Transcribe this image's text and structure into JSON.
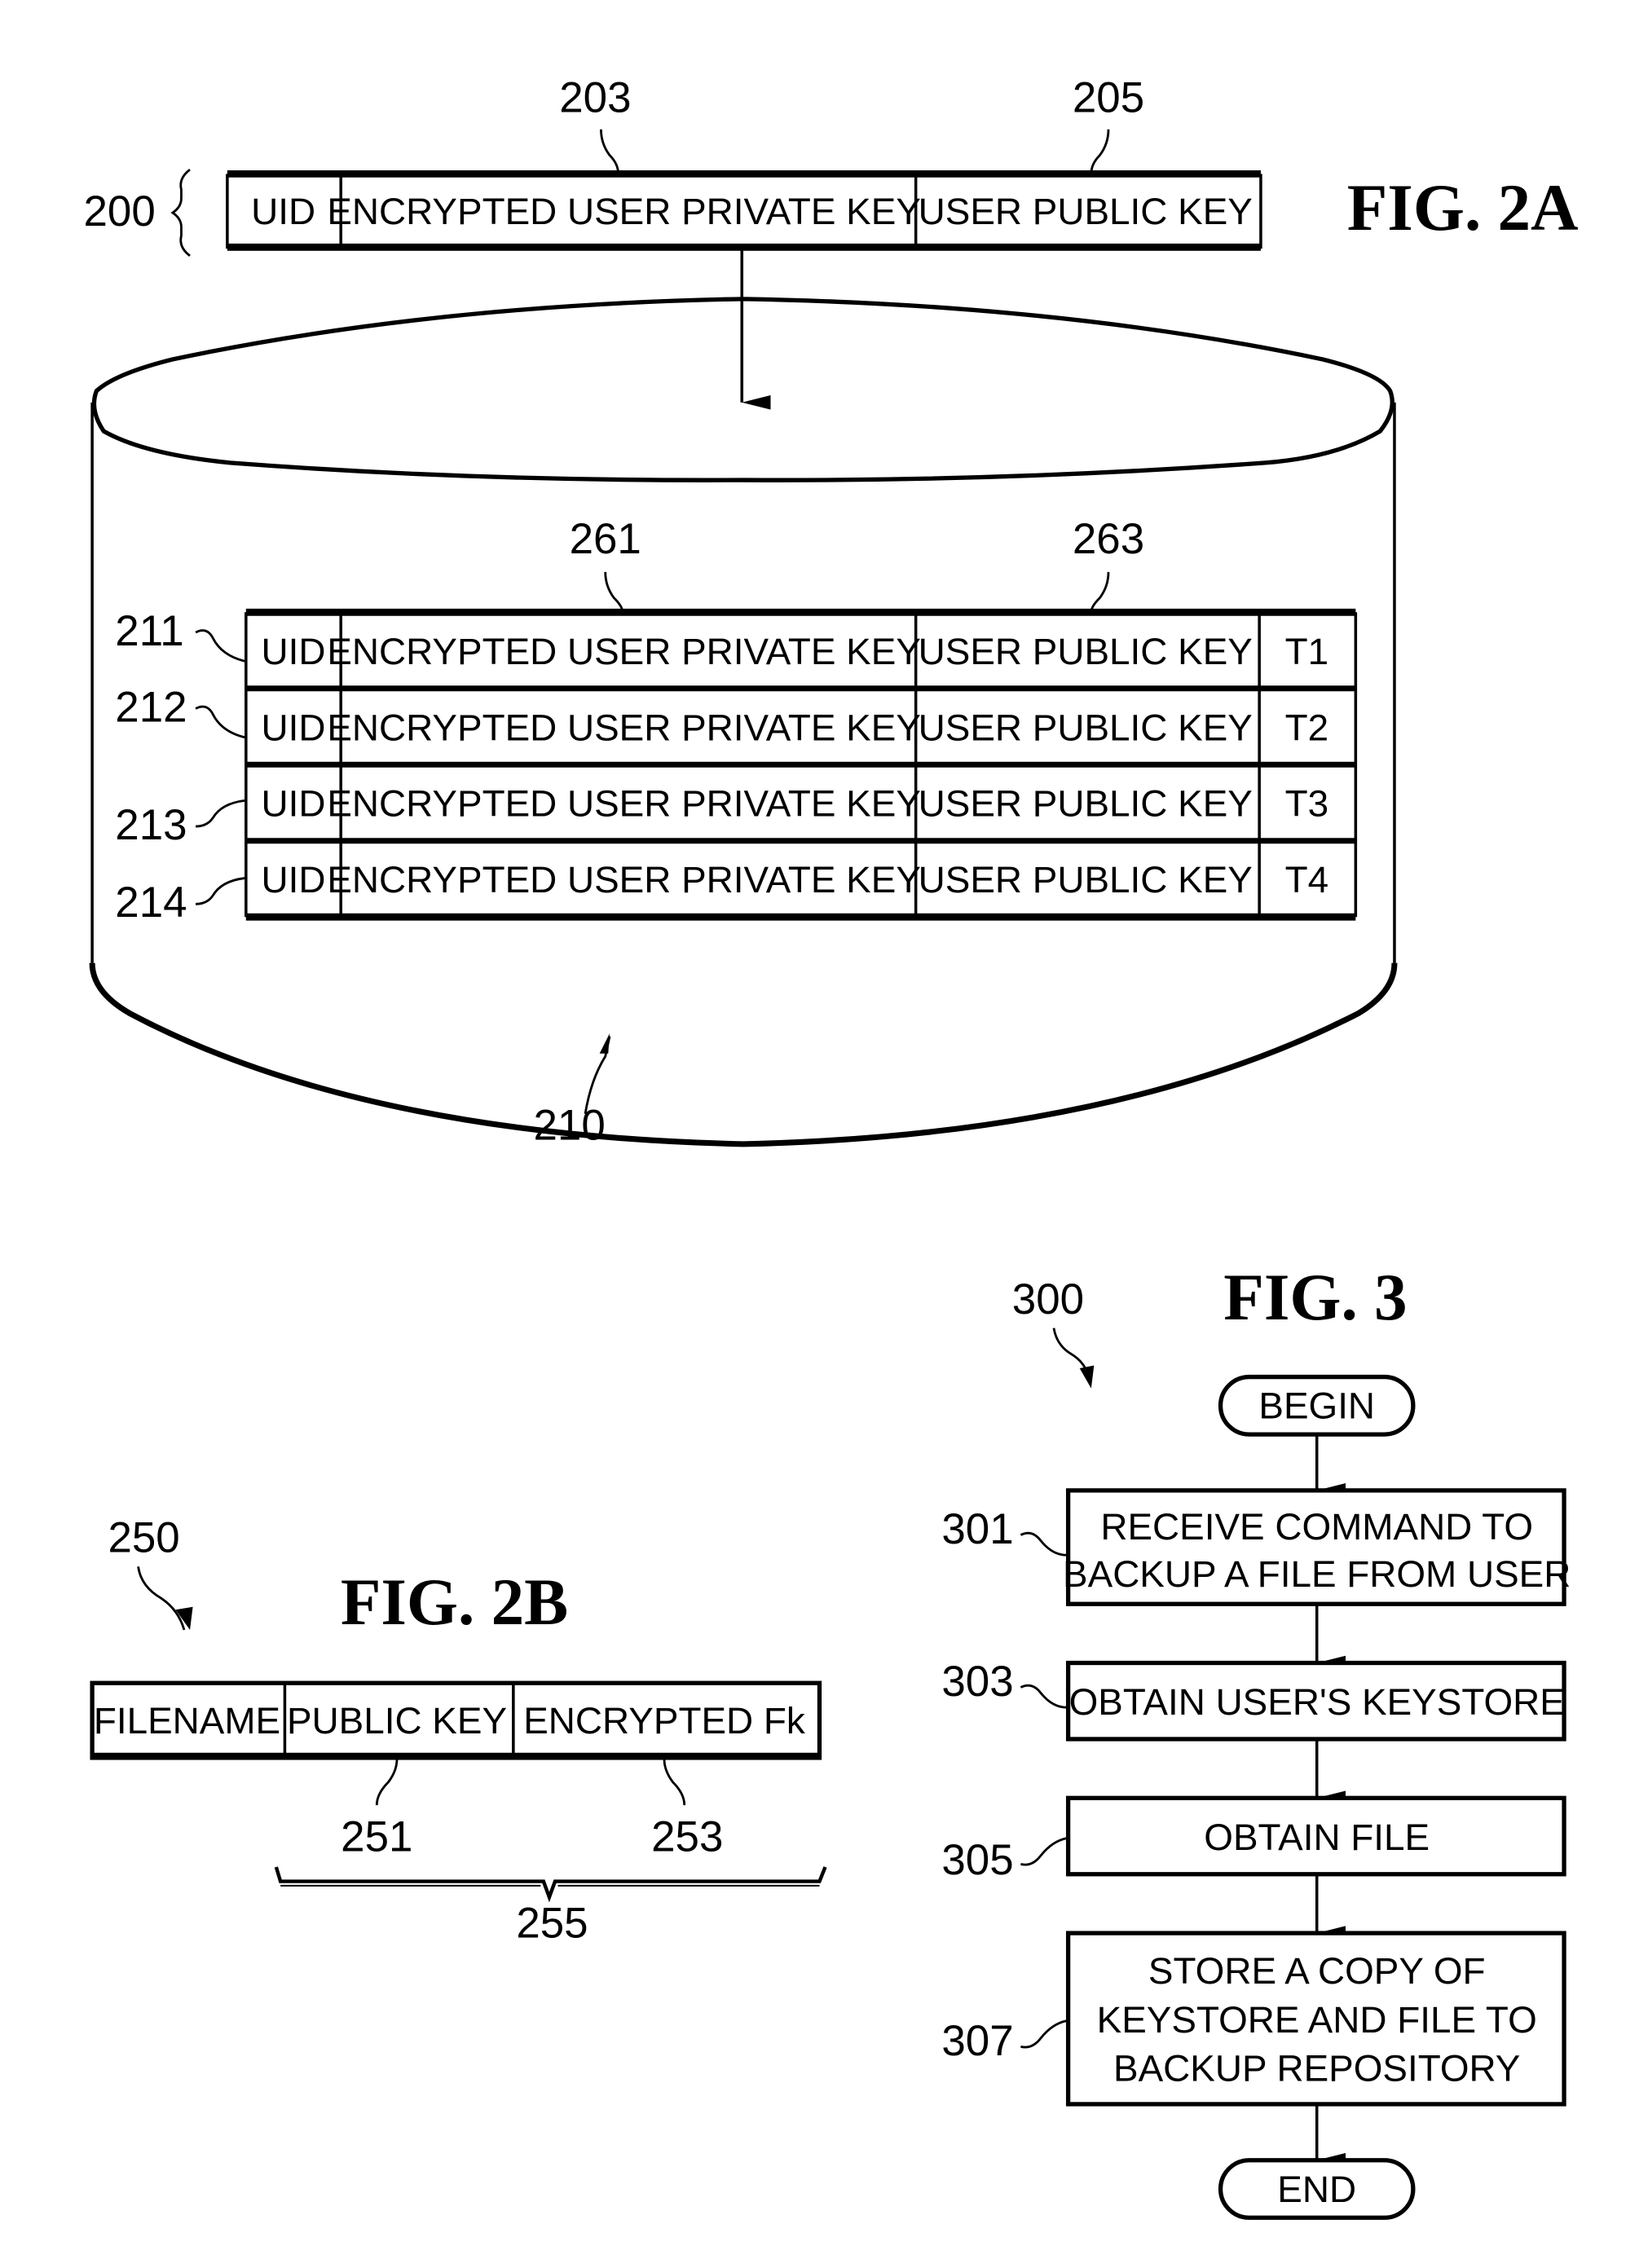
{
  "fig2a": {
    "title": "FIG. 2A",
    "record_ref": "200",
    "record_fields": [
      "UID",
      "ENCRYPTED USER PRIVATE KEY",
      "USER PUBLIC KEY"
    ],
    "field_refs": {
      "private_key": "203",
      "public_key": "205"
    },
    "database_ref": "210",
    "table_column_refs": {
      "private_key": "261",
      "public_key": "263"
    },
    "table_rows": [
      {
        "ref": "211",
        "cells": [
          "UID",
          "ENCRYPTED USER PRIVATE KEY",
          "USER PUBLIC KEY",
          "T1"
        ]
      },
      {
        "ref": "212",
        "cells": [
          "UID",
          "ENCRYPTED USER PRIVATE KEY",
          "USER PUBLIC KEY",
          "T2"
        ]
      },
      {
        "ref": "213",
        "cells": [
          "UID",
          "ENCRYPTED USER PRIVATE KEY",
          "USER PUBLIC KEY",
          "T3"
        ]
      },
      {
        "ref": "214",
        "cells": [
          "UID",
          "ENCRYPTED USER PRIVATE KEY",
          "USER PUBLIC KEY",
          "T4"
        ]
      }
    ]
  },
  "fig2b": {
    "title": "FIG. 2B",
    "ref": "250",
    "fields": [
      "FILENAME",
      "PUBLIC KEY",
      "ENCRYPTED Fk"
    ],
    "field_refs": {
      "public_key": "251",
      "encrypted_fk": "253"
    },
    "group_ref": "255"
  },
  "fig3": {
    "title": "FIG. 3",
    "ref": "300",
    "begin_label": "BEGIN",
    "end_label": "END",
    "steps": [
      {
        "ref": "301",
        "lines": [
          "RECEIVE COMMAND TO",
          "BACKUP A FILE FROM USER"
        ]
      },
      {
        "ref": "303",
        "lines": [
          "OBTAIN USER'S KEYSTORE"
        ]
      },
      {
        "ref": "305",
        "lines": [
          "OBTAIN FILE"
        ]
      },
      {
        "ref": "307",
        "lines": [
          "STORE A COPY OF",
          "KEYSTORE AND FILE TO",
          "BACKUP REPOSITORY"
        ]
      }
    ]
  }
}
